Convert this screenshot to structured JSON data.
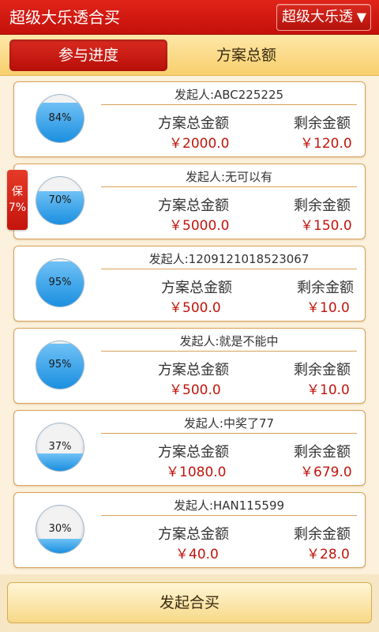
{
  "header": {
    "title": "超级大乐透合买",
    "lottery_select": "超级大乐透",
    "arrow": "▼"
  },
  "tabs": [
    {
      "label": "参与进度",
      "active": true
    },
    {
      "label": "方案总额",
      "active": false
    }
  ],
  "guarantee_badge": {
    "line1": "保",
    "line2": "7%"
  },
  "labels": {
    "total": "方案总金额",
    "remaining": "剩余金额"
  },
  "colors": {
    "accent": "#c4100a",
    "progress_fill": "#1b8fe0",
    "amount": "#c0150c"
  },
  "plans": [
    {
      "progress_label": "84%",
      "progress": 0.84,
      "initiator": "发起人:ABC225225",
      "total": "￥2000.0",
      "remaining": "￥120.0"
    },
    {
      "progress_label": "70%",
      "progress": 0.7,
      "initiator": "发起人:无可以有",
      "total": "￥5000.0",
      "remaining": "￥150.0"
    },
    {
      "progress_label": "95%",
      "progress": 0.95,
      "initiator": "发起人:1209121018523067",
      "total": "￥500.0",
      "remaining": "￥10.0"
    },
    {
      "progress_label": "95%",
      "progress": 0.95,
      "initiator": "发起人:就是不能中",
      "total": "￥500.0",
      "remaining": "￥10.0"
    },
    {
      "progress_label": "37%",
      "progress": 0.37,
      "initiator": "发起人:中奖了77",
      "total": "￥1080.0",
      "remaining": "￥679.0"
    },
    {
      "progress_label": "30%",
      "progress": 0.3,
      "initiator": "发起人:HAN115599",
      "total": "￥40.0",
      "remaining": "￥28.0"
    }
  ],
  "footer": {
    "launch_label": "发起合买"
  }
}
